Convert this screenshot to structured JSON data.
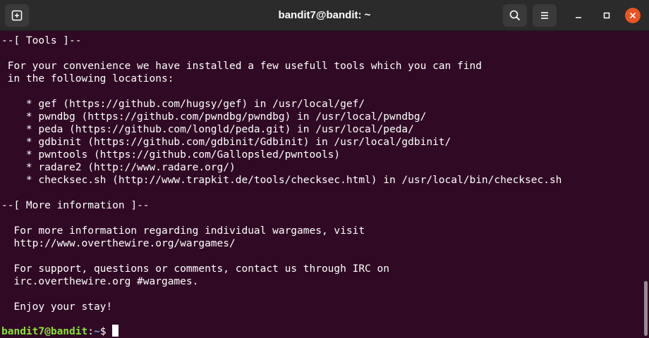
{
  "window": {
    "title": "bandit7@bandit: ~"
  },
  "lines": [
    "--[ Tools ]--",
    "",
    " For your convenience we have installed a few usefull tools which you can find",
    " in the following locations:",
    "",
    "    * gef (https://github.com/hugsy/gef) in /usr/local/gef/",
    "    * pwndbg (https://github.com/pwndbg/pwndbg) in /usr/local/pwndbg/",
    "    * peda (https://github.com/longld/peda.git) in /usr/local/peda/",
    "    * gdbinit (https://github.com/gdbinit/Gdbinit) in /usr/local/gdbinit/",
    "    * pwntools (https://github.com/Gallopsled/pwntools)",
    "    * radare2 (http://www.radare.org/)",
    "    * checksec.sh (http://www.trapkit.de/tools/checksec.html) in /usr/local/bin/checksec.sh",
    "",
    "--[ More information ]--",
    "",
    "  For more information regarding individual wargames, visit",
    "  http://www.overthewire.org/wargames/",
    "",
    "  For support, questions or comments, contact us through IRC on",
    "  irc.overthewire.org #wargames.",
    "",
    "  Enjoy your stay!",
    ""
  ],
  "prompt": {
    "user_host": "bandit7@bandit",
    "separator": ":",
    "path": "~",
    "symbol": "$ "
  },
  "colors": {
    "background": "#300a24",
    "titlebar": "#2b2b2b",
    "prompt_user": "#8ae234",
    "prompt_path": "#729fcf",
    "close": "#e95420"
  },
  "icons": {
    "new_tab": "new-tab-icon",
    "search": "search-icon",
    "menu": "hamburger-menu-icon",
    "minimize": "minimize-icon",
    "maximize": "maximize-icon",
    "close": "close-icon"
  }
}
